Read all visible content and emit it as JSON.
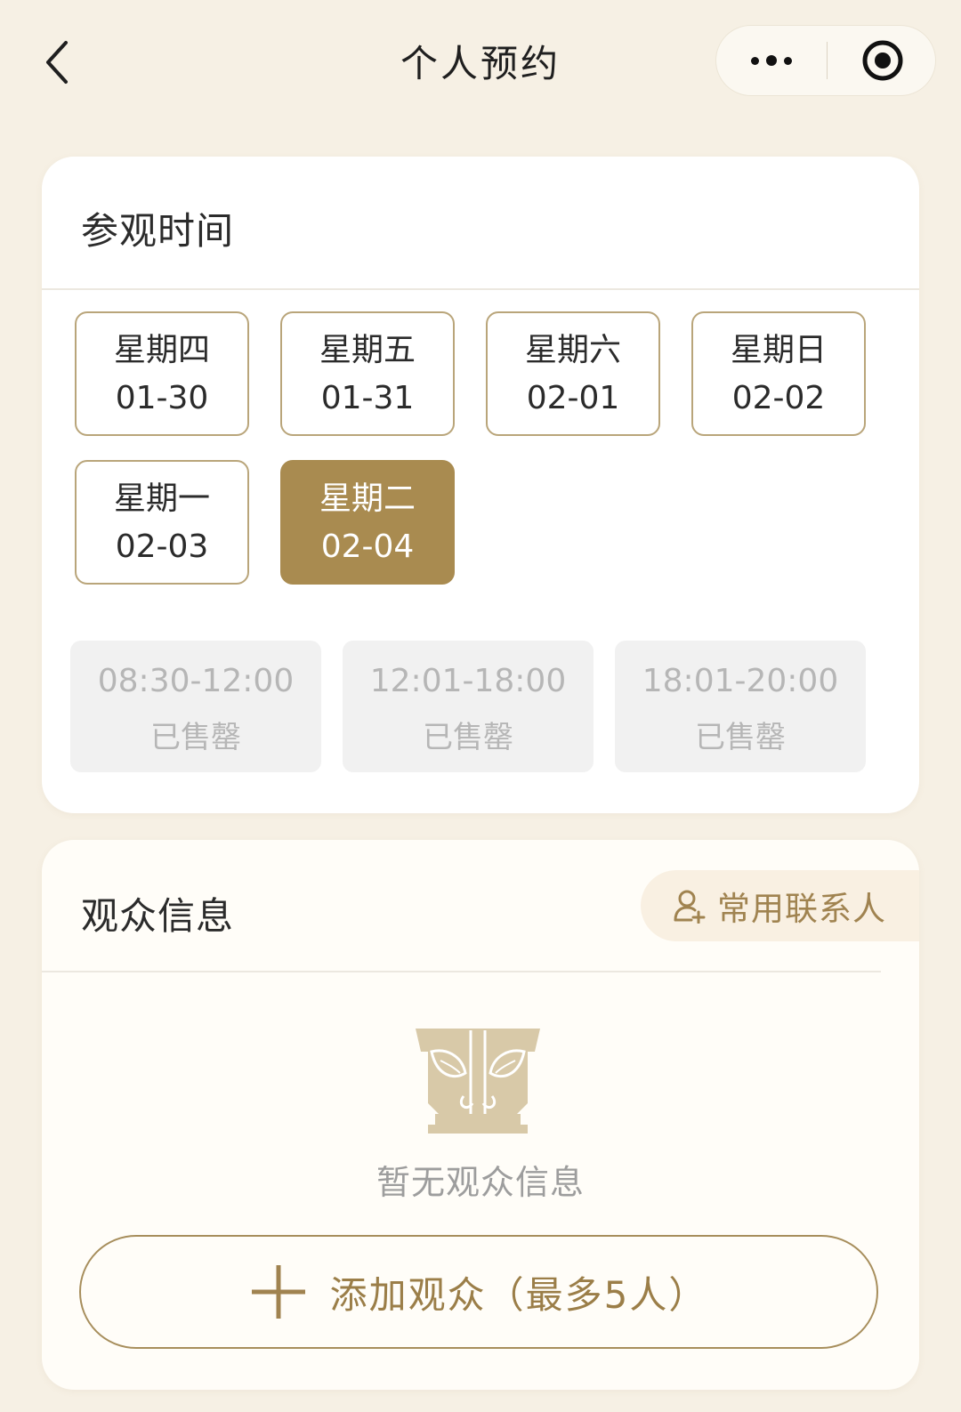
{
  "header": {
    "title": "个人预约"
  },
  "visit_time": {
    "title": "参观时间",
    "dates": [
      {
        "weekday": "星期四",
        "date": "01-30",
        "selected": false
      },
      {
        "weekday": "星期五",
        "date": "01-31",
        "selected": false
      },
      {
        "weekday": "星期六",
        "date": "02-01",
        "selected": false
      },
      {
        "weekday": "星期日",
        "date": "02-02",
        "selected": false
      },
      {
        "weekday": "星期一",
        "date": "02-03",
        "selected": false
      },
      {
        "weekday": "星期二",
        "date": "02-04",
        "selected": true
      }
    ],
    "slots": [
      {
        "time": "08:30-12:00",
        "status": "已售罄"
      },
      {
        "time": "12:01-18:00",
        "status": "已售罄"
      },
      {
        "time": "18:01-20:00",
        "status": "已售罄"
      }
    ]
  },
  "visitor_info": {
    "title": "观众信息",
    "contacts_label": "常用联系人",
    "empty_text": "暂无观众信息",
    "add_label": "添加观众（最多5人）"
  },
  "icons": {
    "back": "chevron-left-icon",
    "more": "more-dots-icon",
    "close": "target-icon",
    "contacts": "add-person-icon",
    "empty": "bronze-mask-icon",
    "add": "plus-icon"
  },
  "colors": {
    "background": "#f6f0e4",
    "accent": "#a98b50",
    "date_border": "#b9a57a",
    "disabled_bg": "#f1f1f1",
    "disabled_text": "#b6b6b6",
    "contacts_bg": "#f9f0e2"
  }
}
